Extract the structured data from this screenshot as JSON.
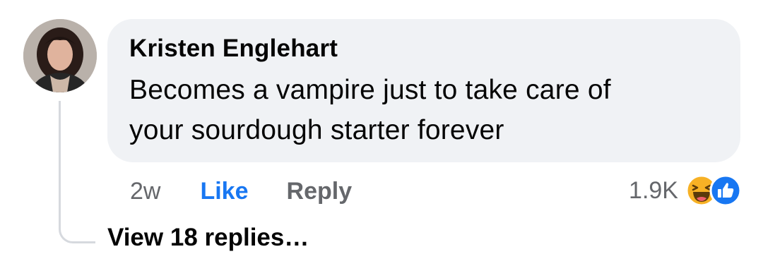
{
  "comment": {
    "author": "Kristen Englehart",
    "text_line1": "Becomes a vampire just to take care of",
    "text_line2": "your sourdough starter forever",
    "time": "2w",
    "like_label": "Like",
    "reply_label": "Reply",
    "reaction_count": "1.9K",
    "reaction_icons": [
      "haha-emoji-icon",
      "like-thumb-icon"
    ]
  },
  "replies": {
    "view_label": "View 18 replies…"
  },
  "colors": {
    "like_blue": "#1877f2",
    "bubble_bg": "#f0f2f5",
    "muted_text": "#65676b"
  }
}
